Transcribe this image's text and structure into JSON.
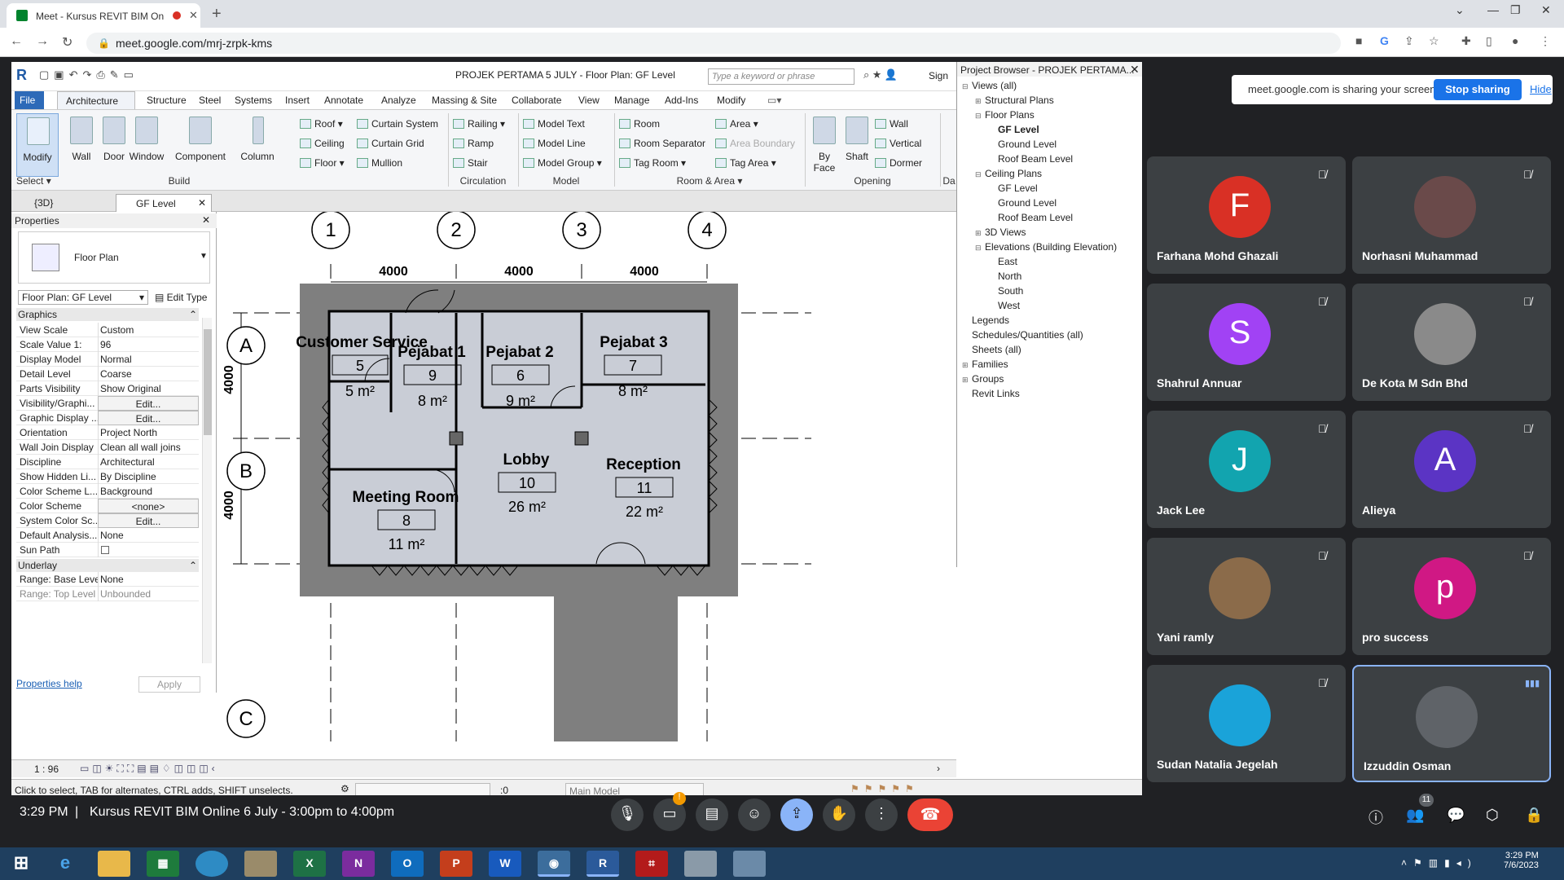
{
  "browser": {
    "tab_title": "Meet - Kursus REVIT BIM On",
    "url": "meet.google.com/mrj-zrpk-kms"
  },
  "revit": {
    "window_title": "PROJEK PERTAMA 5 JULY - Floor Plan: GF Level",
    "search_placeholder": "Type a keyword or phrase",
    "sign_in": "Sign",
    "menu": [
      "File",
      "Architecture",
      "Structure",
      "Steel",
      "Systems",
      "Insert",
      "Annotate",
      "Analyze",
      "Massing & Site",
      "Collaborate",
      "View",
      "Manage",
      "Add-Ins",
      "Modify"
    ],
    "big_tools": [
      "Modify",
      "Wall",
      "Door",
      "Window",
      "Component",
      "Column"
    ],
    "build_col1": [
      "Roof",
      "Ceiling",
      "Floor"
    ],
    "build_col2": [
      "Curtain System",
      "Curtain Grid",
      "Mullion"
    ],
    "circulation": [
      "Railing",
      "Ramp",
      "Stair"
    ],
    "model": [
      "Model Text",
      "Model Line",
      "Model Group"
    ],
    "room_col1": [
      "Room",
      "Room Separator",
      "Tag Room"
    ],
    "room_col2": [
      "Area",
      "Area Boundary",
      "Tag Area"
    ],
    "opening_big": [
      "By Face",
      "Shaft"
    ],
    "opening_small": [
      "Wall",
      "Vertical",
      "Dormer"
    ],
    "groups": {
      "select": "Select",
      "build": "Build",
      "circulation": "Circulation",
      "model": "Model",
      "room": "Room & Area",
      "opening": "Opening",
      "datum": "Da"
    },
    "view_tabs": {
      "v3d": "{3D}",
      "gf": "GF Level"
    },
    "properties": {
      "header": "Properties",
      "type": "Floor Plan",
      "selector": "Floor Plan: GF Level",
      "edit_type": "Edit Type",
      "section_graphics": "Graphics",
      "rows": [
        {
          "k": "View Scale",
          "v": "Custom"
        },
        {
          "k": "Scale Value    1:",
          "v": "96"
        },
        {
          "k": "Display Model",
          "v": "Normal"
        },
        {
          "k": "Detail Level",
          "v": "Coarse"
        },
        {
          "k": "Parts Visibility",
          "v": "Show Original"
        },
        {
          "k": "Visibility/Graphi...",
          "v": "Edit..."
        },
        {
          "k": "Graphic Display ...",
          "v": "Edit..."
        },
        {
          "k": "Orientation",
          "v": "Project North"
        },
        {
          "k": "Wall Join Display",
          "v": "Clean all wall joins"
        },
        {
          "k": "Discipline",
          "v": "Architectural"
        },
        {
          "k": "Show Hidden Li...",
          "v": "By Discipline"
        },
        {
          "k": "Color Scheme L...",
          "v": "Background"
        },
        {
          "k": "Color Scheme",
          "v": "<none>"
        },
        {
          "k": "System Color Sc...",
          "v": "Edit..."
        },
        {
          "k": "Default Analysis...",
          "v": "None"
        },
        {
          "k": "Sun Path",
          "v": ""
        }
      ],
      "section_underlay": "Underlay",
      "underlay_rows": [
        {
          "k": "Range: Base Level",
          "v": "None"
        },
        {
          "k": "Range: Top Level",
          "v": "Unbounded"
        }
      ],
      "help": "Properties help",
      "apply": "Apply"
    },
    "plan": {
      "grid_cols": [
        "1",
        "2",
        "3",
        "4"
      ],
      "grid_rows": [
        "A",
        "B",
        "C"
      ],
      "dims_h": [
        "4000",
        "4000",
        "4000"
      ],
      "dims_v": [
        "4000",
        "4000"
      ],
      "rooms": [
        {
          "name": "Customer Service",
          "num": "5",
          "area": "5 m²"
        },
        {
          "name": "Pejabat 1",
          "num": "9",
          "area": "8 m²"
        },
        {
          "name": "Pejabat 2",
          "num": "6",
          "area": "9 m²"
        },
        {
          "name": "Pejabat 3",
          "num": "7",
          "area": "8 m²"
        },
        {
          "name": "Lobby",
          "num": "10",
          "area": "26 m²"
        },
        {
          "name": "Reception",
          "num": "11",
          "area": "22 m²"
        },
        {
          "name": "Meeting Room",
          "num": "8",
          "area": "11 m²"
        }
      ]
    },
    "browser_panel": {
      "title": "Project Browser - PROJEK PERTAMA...",
      "items": [
        {
          "t": "Views (all)",
          "lvl": 0,
          "tw": "⊟"
        },
        {
          "t": "Structural Plans",
          "lvl": 1,
          "tw": "⊞"
        },
        {
          "t": "Floor Plans",
          "lvl": 1,
          "tw": "⊟"
        },
        {
          "t": "GF Level",
          "lvl": 2,
          "tw": "",
          "sel": true
        },
        {
          "t": "Ground Level",
          "lvl": 2,
          "tw": ""
        },
        {
          "t": "Roof Beam Level",
          "lvl": 2,
          "tw": ""
        },
        {
          "t": "Ceiling Plans",
          "lvl": 1,
          "tw": "⊟"
        },
        {
          "t": "GF Level",
          "lvl": 2,
          "tw": ""
        },
        {
          "t": "Ground Level",
          "lvl": 2,
          "tw": ""
        },
        {
          "t": "Roof Beam Level",
          "lvl": 2,
          "tw": ""
        },
        {
          "t": "3D Views",
          "lvl": 1,
          "tw": "⊞"
        },
        {
          "t": "Elevations (Building Elevation)",
          "lvl": 1,
          "tw": "⊟"
        },
        {
          "t": "East",
          "lvl": 2,
          "tw": ""
        },
        {
          "t": "North",
          "lvl": 2,
          "tw": ""
        },
        {
          "t": "South",
          "lvl": 2,
          "tw": ""
        },
        {
          "t": "West",
          "lvl": 2,
          "tw": ""
        },
        {
          "t": "Legends",
          "lvl": 0,
          "tw": ""
        },
        {
          "t": "Schedules/Quantities (all)",
          "lvl": 0,
          "tw": ""
        },
        {
          "t": "Sheets (all)",
          "lvl": 0,
          "tw": ""
        },
        {
          "t": "Families",
          "lvl": 0,
          "tw": "⊞"
        },
        {
          "t": "Groups",
          "lvl": 0,
          "tw": "⊞"
        },
        {
          "t": "Revit Links",
          "lvl": 0,
          "tw": ""
        }
      ]
    },
    "view_scale": "1 : 96",
    "status": "Click to select, TAB for alternates, CTRL adds, SHIFT unselects.",
    "status_count": ":0",
    "main_model": "Main Model"
  },
  "meet": {
    "share_msg": "meet.google.com is sharing your screen.",
    "stop": "Stop sharing",
    "hide": "Hide",
    "participants": [
      {
        "name": "Farhana Mohd Ghazali",
        "initial": "F",
        "color": "#d93025"
      },
      {
        "name": "Norhasni Muhammad",
        "initial": "",
        "color": "#6a4a4a"
      },
      {
        "name": "Shahrul Annuar",
        "initial": "S",
        "color": "#a142f4"
      },
      {
        "name": "De Kota M Sdn Bhd",
        "initial": "",
        "color": "#8a8a8a"
      },
      {
        "name": "Jack Lee",
        "initial": "J",
        "color": "#12a4af"
      },
      {
        "name": "Alieya",
        "initial": "A",
        "color": "#5b34c4"
      },
      {
        "name": "Yani ramly",
        "initial": "",
        "color": "#8b6b4a"
      },
      {
        "name": "pro success",
        "initial": "p",
        "color": "#d01884"
      },
      {
        "name": "Sudan Natalia Jegelah",
        "initial": "",
        "color": "#1aa3d9"
      },
      {
        "name": "Izzuddin Osman",
        "initial": "",
        "color": "#5f6368"
      }
    ],
    "time": "3:29 PM",
    "meeting_title": "Kursus REVIT BIM Online 6 July - 3:00pm to 4:00pm",
    "people_count": "11",
    "notif_count": "!"
  },
  "taskbar": {
    "clock_time": "3:29 PM",
    "clock_date": "7/6/2023"
  }
}
